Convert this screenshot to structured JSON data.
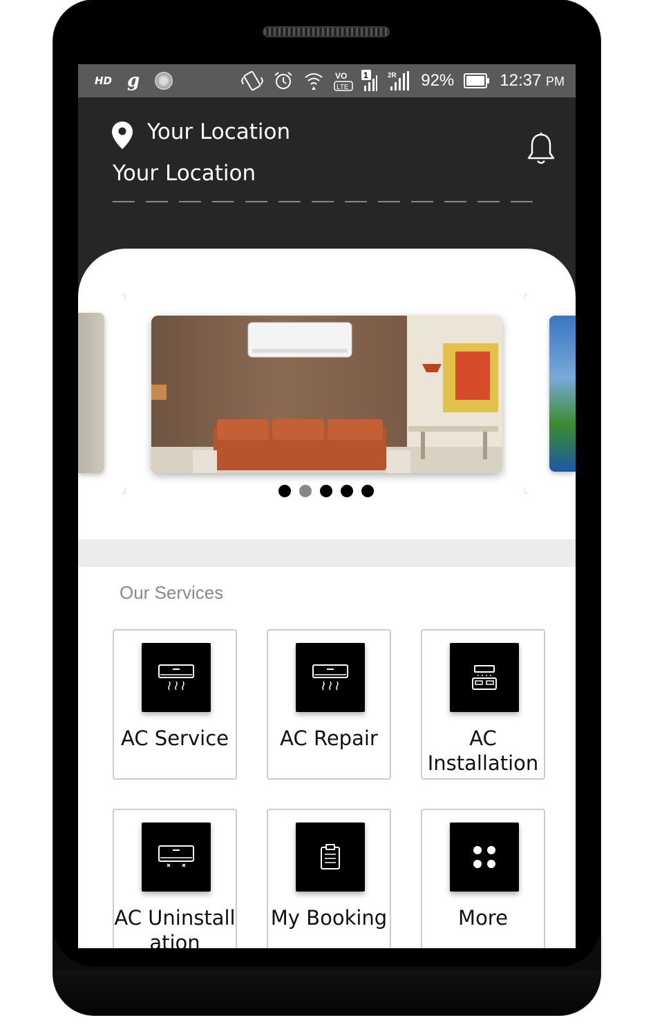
{
  "status_bar": {
    "hd": "HD",
    "g_icon": "g",
    "sim1": "1",
    "sim2": "2R",
    "volte": "VoLTE",
    "battery": "92%",
    "time": "12:37",
    "ampm": "PM"
  },
  "header": {
    "location_title": "Your Location",
    "location_subtitle": "Your Location",
    "pin_icon": "location-pin-icon",
    "bell_icon": "bell-icon"
  },
  "slider": {
    "dots": 5,
    "active_index": 1
  },
  "services": {
    "title": "Our Services",
    "items": [
      {
        "label": "AC Service",
        "icon": "ac-unit-icon"
      },
      {
        "label": "AC Repair",
        "icon": "ac-unit-icon"
      },
      {
        "label": "AC Installation",
        "icon": "ac-installation-icon"
      },
      {
        "label": "AC Uninstallation",
        "icon": "ac-uninstall-icon"
      },
      {
        "label": "My Booking",
        "icon": "clipboard-icon"
      },
      {
        "label": "More",
        "icon": "grid-dots-icon"
      }
    ]
  },
  "colors": {
    "header_bg": "#262626",
    "status_bg": "#5a5a5a",
    "icon_tile_bg": "#000000",
    "divider": "#ececec"
  }
}
